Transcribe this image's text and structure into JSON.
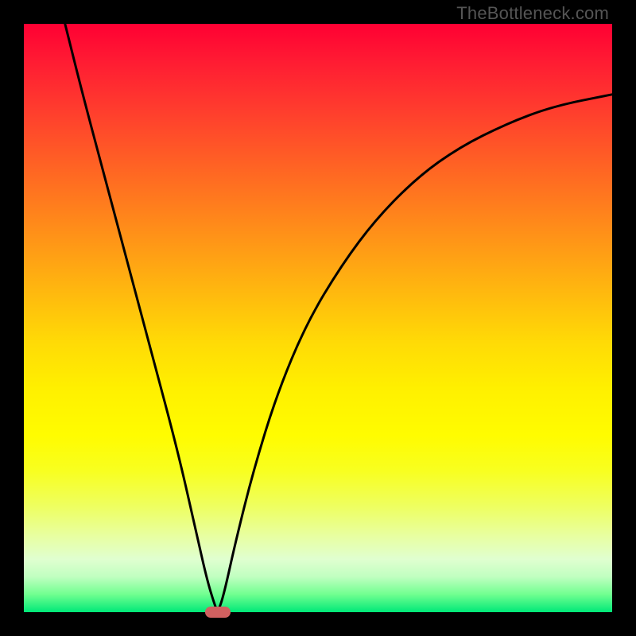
{
  "watermark": "TheBottleneck.com",
  "chart_data": {
    "type": "line",
    "title": "",
    "xlabel": "",
    "ylabel": "",
    "xlim": [
      0,
      100
    ],
    "ylim": [
      0,
      100
    ],
    "grid": false,
    "series": [
      {
        "name": "curve",
        "x": [
          7,
          10,
          14,
          18,
          22,
          26,
          29,
          31,
          32.5,
          33,
          34,
          36,
          39,
          43,
          48,
          54,
          60,
          67,
          74,
          82,
          90,
          100
        ],
        "y": [
          100,
          88,
          73,
          58,
          43,
          28,
          15,
          6,
          1,
          0,
          3,
          12,
          24,
          37,
          49,
          59,
          67,
          74,
          79,
          83,
          86,
          88
        ]
      }
    ],
    "marker": {
      "x": 33,
      "y": 0
    },
    "annotations": []
  },
  "colors": {
    "frame": "#000000",
    "curve": "#000000",
    "marker": "#d06060"
  }
}
